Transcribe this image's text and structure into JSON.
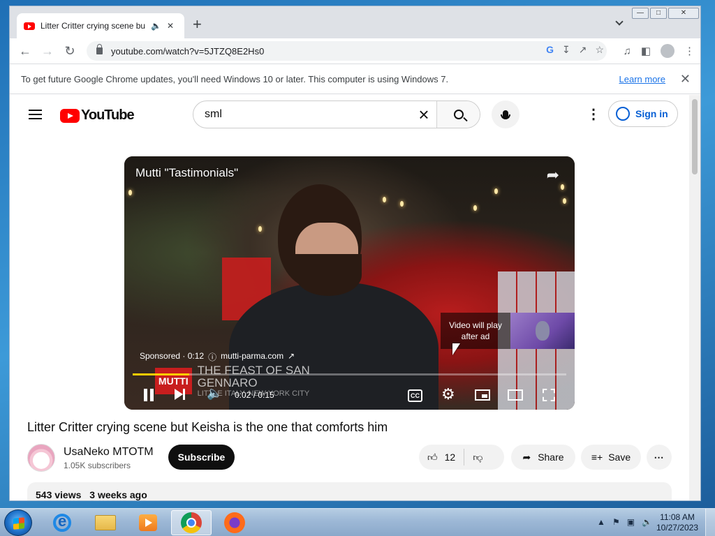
{
  "browser": {
    "tab_title": "Litter Critter crying scene but Keisha is the one that comforts him",
    "tab_audio_icon": "speaker-icon",
    "url": "youtube.com/watch?v=5JTZQ8E2Hs0",
    "infobar": {
      "message": "To get future Google Chrome updates, you'll need Windows 10 or later. This computer is using Windows 7.",
      "learn_more": "Learn more"
    }
  },
  "youtube": {
    "logo_text": "YouTube",
    "search_value": "sml",
    "sign_in": "Sign in"
  },
  "player": {
    "ad_title": "Mutti \"Tastimonials\"",
    "ad_notice": "Video will play after ad",
    "sponsored": "Sponsored · 0:12",
    "advertiser_url": "mutti-parma.com",
    "lower_third_logo": "MUTTI",
    "lower_third_caption": "THE FEAST OF SAN GENNARO",
    "lower_third_sub": "LITTLE ITALY, NEW YORK CITY",
    "time": "0:02 / 0:15",
    "progress_fraction": 0.13,
    "cc_label": "CC",
    "colors": {
      "progress": "#ffcc00"
    }
  },
  "video": {
    "title": "Litter Critter crying scene but Keisha is the one that comforts him",
    "channel_name": "UsaNeko MTOTM",
    "subscribers": "1.05K subscribers",
    "subscribe": "Subscribe",
    "likes": "12",
    "share": "Share",
    "save": "Save",
    "views": "543 views",
    "age": "3 weeks ago"
  },
  "taskbar": {
    "time": "11:08 AM",
    "date": "10/27/2023"
  }
}
